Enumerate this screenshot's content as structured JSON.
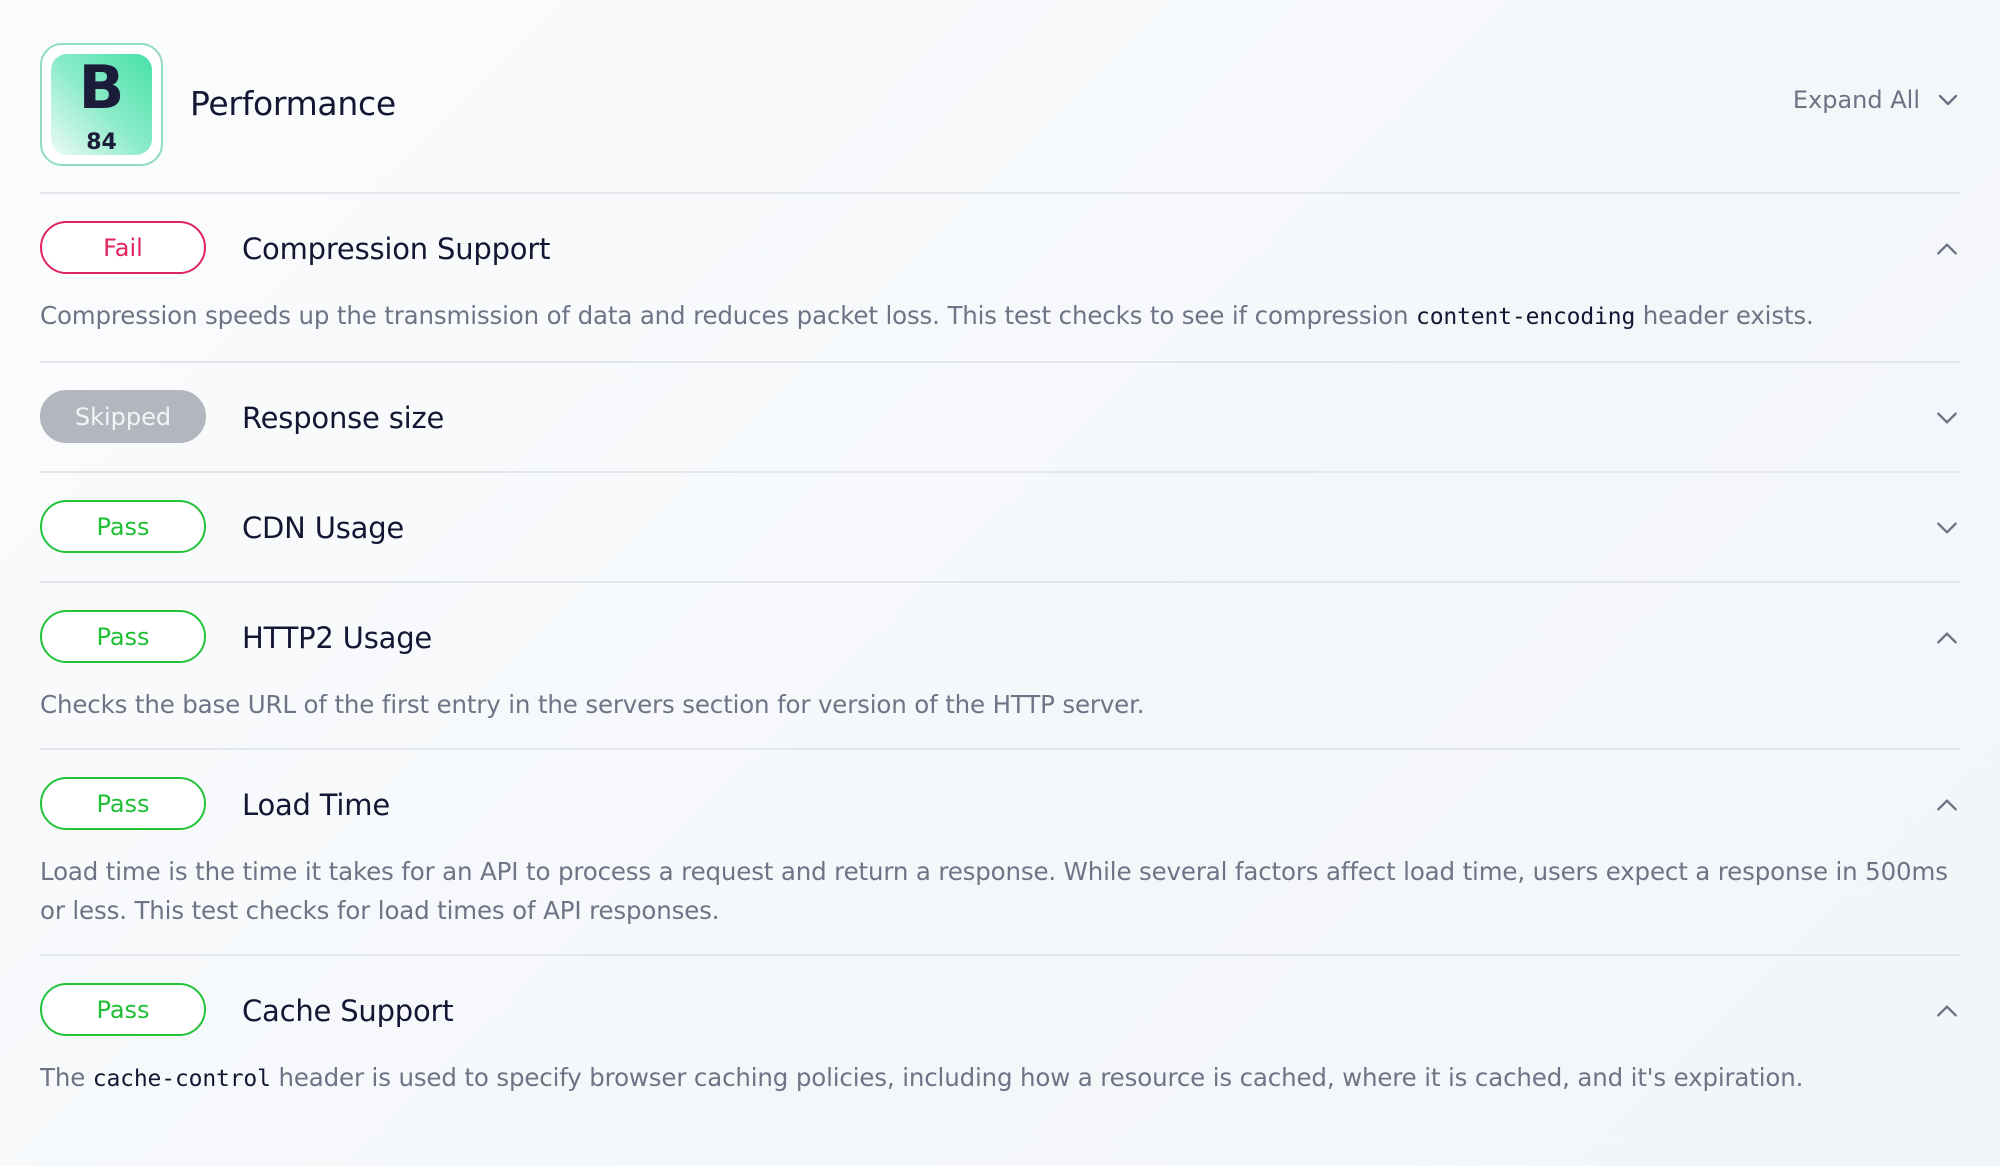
{
  "header": {
    "grade_letter": "B",
    "grade_score": "84",
    "title": "Performance",
    "expand_all_label": "Expand All",
    "expand_all_icon": "chevron-down-icon"
  },
  "colors": {
    "fail": "#e0245e",
    "pass": "#22c33a",
    "skipped": "#b3b6bf",
    "grade_gradient_start": "#46e0a8",
    "text_primary": "#141633",
    "text_secondary": "#6f7386"
  },
  "checks": [
    {
      "status": "Fail",
      "title": "Compression Support",
      "expanded": true,
      "chevron_icon": "chevron-up-icon",
      "desc_before": "Compression speeds up the transmission of data and reduces packet loss. This test checks to see if compression ",
      "desc_code": "content-encoding",
      "desc_after": " header exists."
    },
    {
      "status": "Skipped",
      "title": "Response size",
      "expanded": false,
      "chevron_icon": "chevron-down-icon"
    },
    {
      "status": "Pass",
      "title": "CDN Usage",
      "expanded": false,
      "chevron_icon": "chevron-down-icon"
    },
    {
      "status": "Pass",
      "title": "HTTP2 Usage",
      "expanded": true,
      "chevron_icon": "chevron-up-icon",
      "desc": "Checks the base URL of the first entry in the servers section for version of the HTTP server."
    },
    {
      "status": "Pass",
      "title": "Load Time",
      "expanded": true,
      "chevron_icon": "chevron-up-icon",
      "desc": "Load time is the time it takes for an API to process a request and return a response. While several factors affect load time, users expect a response in 500ms or less. This test checks for load times of API responses."
    },
    {
      "status": "Pass",
      "title": "Cache Support",
      "expanded": true,
      "chevron_icon": "chevron-up-icon",
      "desc_before": "The ",
      "desc_code": "cache-control",
      "desc_after": " header is used to specify browser caching policies, including how a resource is cached, where it is cached, and it's expiration."
    }
  ]
}
